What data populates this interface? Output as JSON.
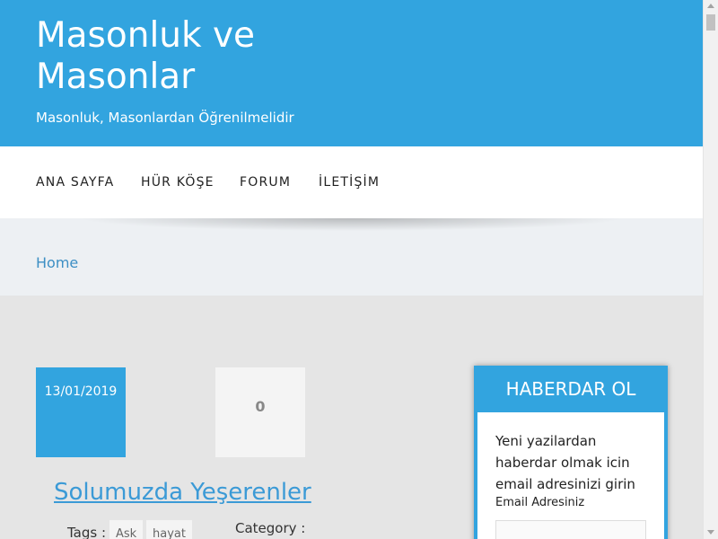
{
  "header": {
    "title": "Masonluk ve Masonlar",
    "tagline": "Masonluk, Masonlardan Öğrenilmelidir"
  },
  "nav": {
    "items": [
      {
        "label": "ANA SAYFA"
      },
      {
        "label": "HÜR KÖŞE"
      },
      {
        "label": "FORUM"
      },
      {
        "label": "İLETİŞİM"
      }
    ]
  },
  "breadcrumb": {
    "home": "Home"
  },
  "post": {
    "date": "13/01/2019",
    "comment_count": "0",
    "title": "Solumuzda Yeşerenler",
    "tags_label": "Tags :",
    "tags": [
      "Ask",
      "hayat"
    ],
    "category_label": "Category :"
  },
  "widget": {
    "title": "HABERDAR OL",
    "description": "Yeni yazilardan haberdar olmak icin email adresinizi girin",
    "email_label": "Email Adresiniz",
    "email_value": ""
  },
  "colors": {
    "brand_blue": "#32a4df",
    "link_blue": "#3b9ad6"
  }
}
